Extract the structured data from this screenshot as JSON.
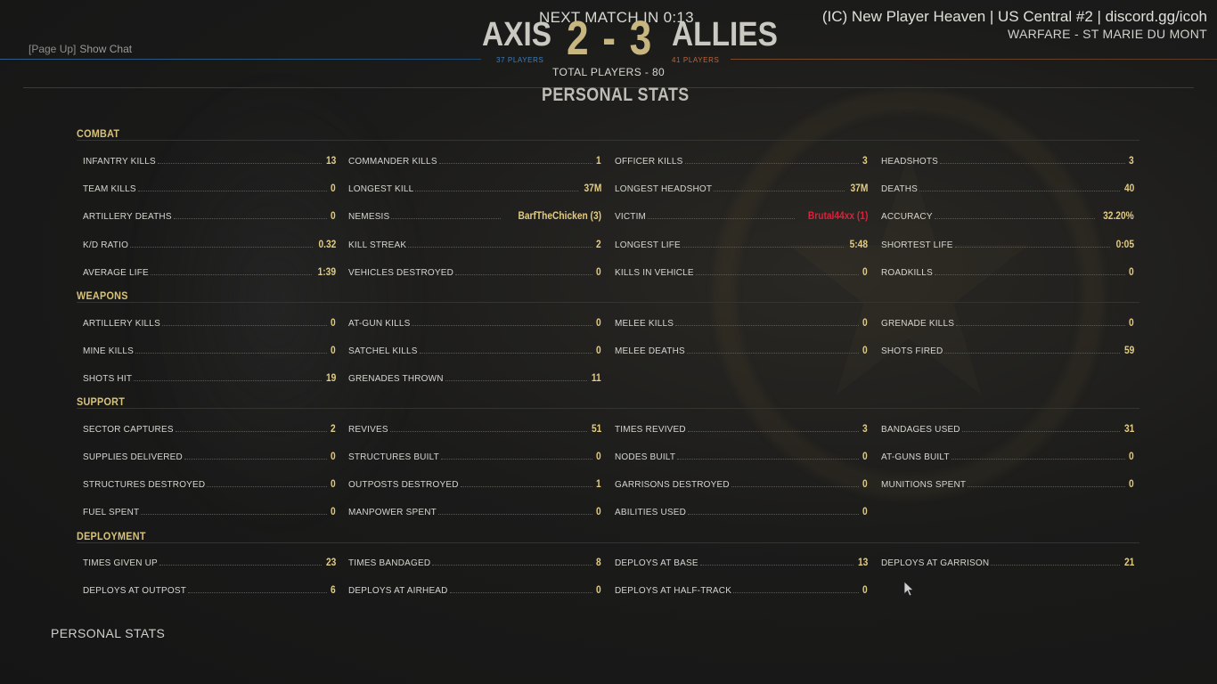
{
  "header": {
    "chat_hint_key": "[Page Up]",
    "chat_hint_label": "Show Chat",
    "next_match": "NEXT MATCH IN 0:13",
    "axis": {
      "name": "AXIS",
      "score": "2",
      "players": "37 PLAYERS"
    },
    "allies": {
      "name": "ALLIES",
      "score": "3",
      "players": "41 PLAYERS"
    },
    "score_sep": "-",
    "total_players": "TOTAL PLAYERS - 80",
    "server_name": "(IC) New Player Heaven | US Central #2 | discord.gg/icoh",
    "map_name": "WARFARE - ST MARIE DU MONT"
  },
  "page_title": "PERSONAL STATS",
  "footer_title": "PERSONAL STATS",
  "colors": {
    "accent_gold": "#d9c37a",
    "value_gold": "#e2cc84",
    "axis_blue": "#3d7fbf",
    "allies_orange": "#c0643c",
    "highlight_red": "#e0203a"
  },
  "sections": [
    {
      "title": "COMBAT",
      "rows": [
        [
          {
            "label": "INFANTRY KILLS",
            "value": "13"
          },
          {
            "label": "COMMANDER KILLS",
            "value": "1"
          },
          {
            "label": "OFFICER KILLS",
            "value": "3"
          },
          {
            "label": "HEADSHOTS",
            "value": "3"
          }
        ],
        [
          {
            "label": "TEAM KILLS",
            "value": "0"
          },
          {
            "label": "LONGEST KILL",
            "value": "37M"
          },
          {
            "label": "LONGEST HEADSHOT",
            "value": "37M"
          },
          {
            "label": "DEATHS",
            "value": "40"
          }
        ],
        [
          {
            "label": "ARTILLERY DEATHS",
            "value": "0"
          },
          {
            "label": "NEMESIS",
            "value": "BarfTheChicken (3)"
          },
          {
            "label": "VICTIM",
            "value": "Brutal44xx (1)",
            "highlight": true
          },
          {
            "label": "ACCURACY",
            "value": "32.20%"
          }
        ],
        [
          {
            "label": "K/D RATIO",
            "value": "0.32"
          },
          {
            "label": "KILL STREAK",
            "value": "2"
          },
          {
            "label": "LONGEST LIFE",
            "value": "5:48"
          },
          {
            "label": "SHORTEST LIFE",
            "value": "0:05"
          }
        ],
        [
          {
            "label": "AVERAGE LIFE",
            "value": "1:39"
          },
          {
            "label": "VEHICLES DESTROYED",
            "value": "0"
          },
          {
            "label": "KILLS IN VEHICLE",
            "value": "0"
          },
          {
            "label": "ROADKILLS",
            "value": "0"
          }
        ]
      ]
    },
    {
      "title": "WEAPONS",
      "rows": [
        [
          {
            "label": "ARTILLERY KILLS",
            "value": "0"
          },
          {
            "label": "AT-GUN KILLS",
            "value": "0"
          },
          {
            "label": "MELEE KILLS",
            "value": "0"
          },
          {
            "label": "GRENADE KILLS",
            "value": "0"
          }
        ],
        [
          {
            "label": "MINE KILLS",
            "value": "0"
          },
          {
            "label": "SATCHEL KILLS",
            "value": "0"
          },
          {
            "label": "MELEE DEATHS",
            "value": "0"
          },
          {
            "label": "SHOTS FIRED",
            "value": "59"
          }
        ],
        [
          {
            "label": "SHOTS HIT",
            "value": "19"
          },
          {
            "label": "GRENADES THROWN",
            "value": "11"
          }
        ]
      ]
    },
    {
      "title": "SUPPORT",
      "rows": [
        [
          {
            "label": "SECTOR CAPTURES",
            "value": "2"
          },
          {
            "label": "REVIVES",
            "value": "51"
          },
          {
            "label": "TIMES REVIVED",
            "value": "3"
          },
          {
            "label": "BANDAGES USED",
            "value": "31"
          }
        ],
        [
          {
            "label": "SUPPLIES DELIVERED",
            "value": "0"
          },
          {
            "label": "STRUCTURES BUILT",
            "value": "0"
          },
          {
            "label": "NODES BUILT",
            "value": "0"
          },
          {
            "label": "AT-GUNS BUILT",
            "value": "0"
          }
        ],
        [
          {
            "label": "STRUCTURES DESTROYED",
            "value": "0"
          },
          {
            "label": "OUTPOSTS DESTROYED",
            "value": "1"
          },
          {
            "label": "GARRISONS DESTROYED",
            "value": "0"
          },
          {
            "label": "MUNITIONS SPENT",
            "value": "0"
          }
        ],
        [
          {
            "label": "FUEL SPENT",
            "value": "0"
          },
          {
            "label": "MANPOWER SPENT",
            "value": "0"
          },
          {
            "label": "ABILITIES USED",
            "value": "0"
          }
        ]
      ]
    },
    {
      "title": "DEPLOYMENT",
      "rows": [
        [
          {
            "label": "TIMES GIVEN UP",
            "value": "23"
          },
          {
            "label": "TIMES BANDAGED",
            "value": "8"
          },
          {
            "label": "DEPLOYS AT BASE",
            "value": "13"
          },
          {
            "label": "DEPLOYS AT GARRISON",
            "value": "21"
          }
        ],
        [
          {
            "label": "DEPLOYS AT OUTPOST",
            "value": "6"
          },
          {
            "label": "DEPLOYS AT AIRHEAD",
            "value": "0"
          },
          {
            "label": "DEPLOYS AT HALF-TRACK",
            "value": "0"
          }
        ]
      ]
    }
  ]
}
